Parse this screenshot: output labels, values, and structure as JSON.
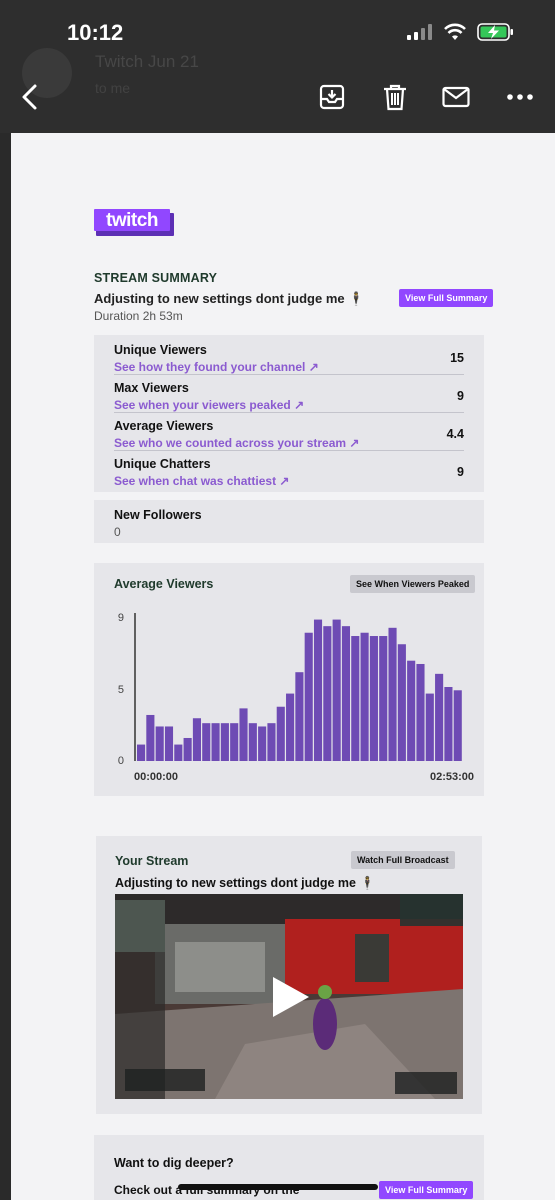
{
  "status_bar": {
    "time": "10:12"
  },
  "mail_header": {
    "sender_ghost": "Twitch   Jun 21",
    "to_ghost": "to me"
  },
  "icons": {
    "back": "chevron-left-icon",
    "archive": "archive-icon",
    "delete": "trash-icon",
    "mark": "mail-icon",
    "more": "more-horizontal-icon"
  },
  "colors": {
    "brand": "#9147ff",
    "link": "#8b5bd0",
    "bar": "#6e4bb4",
    "heading": "#1f3a2c"
  },
  "summary": {
    "section_title": "STREAM SUMMARY",
    "stream_title": "Adjusting to new settings dont judge me 🕴",
    "duration": "Duration 2h 53m",
    "view_button": "View Full Summary"
  },
  "stats": [
    {
      "label": "Unique Viewers",
      "link": "See how they found your channel ↗",
      "value": "15"
    },
    {
      "label": "Max Viewers",
      "link": "See when your viewers peaked ↗",
      "value": "9"
    },
    {
      "label": "Average Viewers",
      "link": "See who we counted across your stream ↗",
      "value": "4.4"
    },
    {
      "label": "Unique Chatters",
      "link": "See when chat was chattiest ↗",
      "value": "9"
    }
  ],
  "followers": {
    "label": "New Followers",
    "value": "0"
  },
  "chart_section": {
    "title": "Average Viewers",
    "button": "See When Viewers Peaked"
  },
  "chart_data": {
    "type": "bar",
    "title": "Average Viewers",
    "yticks": [
      "9",
      "5",
      "0"
    ],
    "ylim": [
      0,
      9
    ],
    "x_start_label": "00:00:00",
    "x_end_label": "02:53:00",
    "values": [
      1,
      2.8,
      2.1,
      2.1,
      1,
      1.4,
      2.6,
      2.3,
      2.3,
      2.3,
      2.3,
      3.2,
      2.3,
      2.1,
      2.3,
      3.3,
      4.1,
      5.4,
      7.8,
      8.6,
      8.2,
      8.6,
      8.2,
      7.6,
      7.8,
      7.6,
      7.6,
      8.1,
      7.1,
      6.1,
      5.9,
      4.1,
      5.3,
      4.5,
      4.3
    ]
  },
  "your_stream": {
    "title": "Your Stream",
    "button": "Watch Full Broadcast",
    "stream_title": "Adjusting to new settings dont judge me 🕴",
    "play_icon": "play-icon"
  },
  "dig_deeper": {
    "question": "Want to dig deeper?",
    "text": "Check out a full summary on the",
    "button": "View Full Summary"
  }
}
